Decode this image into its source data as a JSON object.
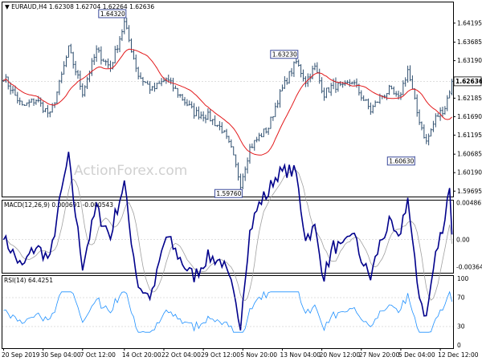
{
  "chart_data": [
    {
      "type": "ohlc",
      "symbol": "EURAUD.H4",
      "header": {
        "symbol": "EURAUD,H4",
        "values": "1.62308 1.62704 1.62264 1.62636"
      },
      "ohlc_last": {
        "open": 1.62308,
        "high": 1.62704,
        "low": 1.62264,
        "close": 1.62636
      },
      "y_ticks": [
        "1.64195",
        "1.63685",
        "1.63190",
        "1.62680",
        "1.62185",
        "1.61690",
        "1.61195",
        "1.60685",
        "1.60190",
        "1.59695"
      ],
      "y_tick_values": [
        1.64195,
        1.63685,
        1.6319,
        1.6268,
        1.62185,
        1.6169,
        1.61195,
        1.60685,
        1.6019,
        1.59695
      ],
      "ylim": [
        1.5955,
        1.6475
      ],
      "last_price_label": "1.62636",
      "last_price": 1.62636,
      "annotations": [
        {
          "label": "1.64320",
          "value": 1.6432,
          "bar": 52
        },
        {
          "label": "1.59760",
          "value": 1.5976,
          "bar": 102
        },
        {
          "label": "1.63230",
          "value": 1.6323,
          "bar": 126
        },
        {
          "label": "1.60630",
          "value": 1.6063,
          "bar": 177
        }
      ],
      "moving_average": {
        "color": "#e31a1c"
      },
      "price_color": "#2f4f6f",
      "anchors": [
        [
          0,
          1.6276
        ],
        [
          8,
          1.6195
        ],
        [
          14,
          1.6215
        ],
        [
          20,
          1.6172
        ],
        [
          24,
          1.6255
        ],
        [
          28,
          1.635
        ],
        [
          34,
          1.6235
        ],
        [
          40,
          1.6345
        ],
        [
          46,
          1.63
        ],
        [
          52,
          1.642
        ],
        [
          58,
          1.628
        ],
        [
          64,
          1.624
        ],
        [
          70,
          1.627
        ],
        [
          76,
          1.6225
        ],
        [
          82,
          1.618
        ],
        [
          88,
          1.617
        ],
        [
          94,
          1.6135
        ],
        [
          98,
          1.608
        ],
        [
          102,
          1.599
        ],
        [
          106,
          1.6085
        ],
        [
          110,
          1.6115
        ],
        [
          114,
          1.614
        ],
        [
          118,
          1.6215
        ],
        [
          122,
          1.627
        ],
        [
          126,
          1.6315
        ],
        [
          130,
          1.6265
        ],
        [
          134,
          1.63
        ],
        [
          138,
          1.623
        ],
        [
          142,
          1.6255
        ],
        [
          146,
          1.6245
        ],
        [
          150,
          1.6265
        ],
        [
          154,
          1.6225
        ],
        [
          158,
          1.6185
        ],
        [
          162,
          1.622
        ],
        [
          166,
          1.624
        ],
        [
          170,
          1.6215
        ],
        [
          174,
          1.6295
        ],
        [
          178,
          1.618
        ],
        [
          182,
          1.61
        ],
        [
          186,
          1.6165
        ],
        [
          190,
          1.6195
        ],
        [
          193,
          1.6264
        ]
      ]
    },
    {
      "type": "line",
      "indicator": "MACD(12,26,9)",
      "header": "MACD(12,26,9) 0.000691 -0.000543",
      "macd": 0.000691,
      "signal": -0.000543,
      "y_ticks": [
        "0.004861",
        "0.00",
        "-0.003642"
      ],
      "y_tick_values": [
        0.004861,
        0.0,
        -0.003642
      ],
      "ylim": [
        -0.0044,
        0.0052
      ],
      "series": [
        {
          "role": "main",
          "color": "#00008b"
        },
        {
          "role": "signal",
          "color": "#a0a0a0"
        }
      ]
    },
    {
      "type": "line",
      "indicator": "RSI(14)",
      "header": "RSI(14) 64.4251",
      "value": 64.4251,
      "y_ticks": [
        "100",
        "70",
        "30",
        "0"
      ],
      "y_tick_values": [
        100,
        70,
        30,
        0
      ],
      "levels": [
        70,
        30
      ],
      "ylim": [
        0,
        100
      ],
      "color": "#1e90ff"
    }
  ],
  "x_ticks": [
    "20 Sep 2019",
    "30 Sep 04:00",
    "7 Oct 12:00",
    "14 Oct 20:00",
    "22 Oct 04:00",
    "29 Oct 12:00",
    "5 Nov 20:00",
    "13 Nov 04:00",
    "20 Nov 12:00",
    "27 Nov 20:00",
    "5 Dec 04:00",
    "12 Dec 12:00"
  ],
  "x_tick_bars": [
    0,
    17,
    34,
    52,
    69,
    86,
    103,
    120,
    137,
    154,
    171,
    188
  ],
  "watermark": "ActionForex.com"
}
